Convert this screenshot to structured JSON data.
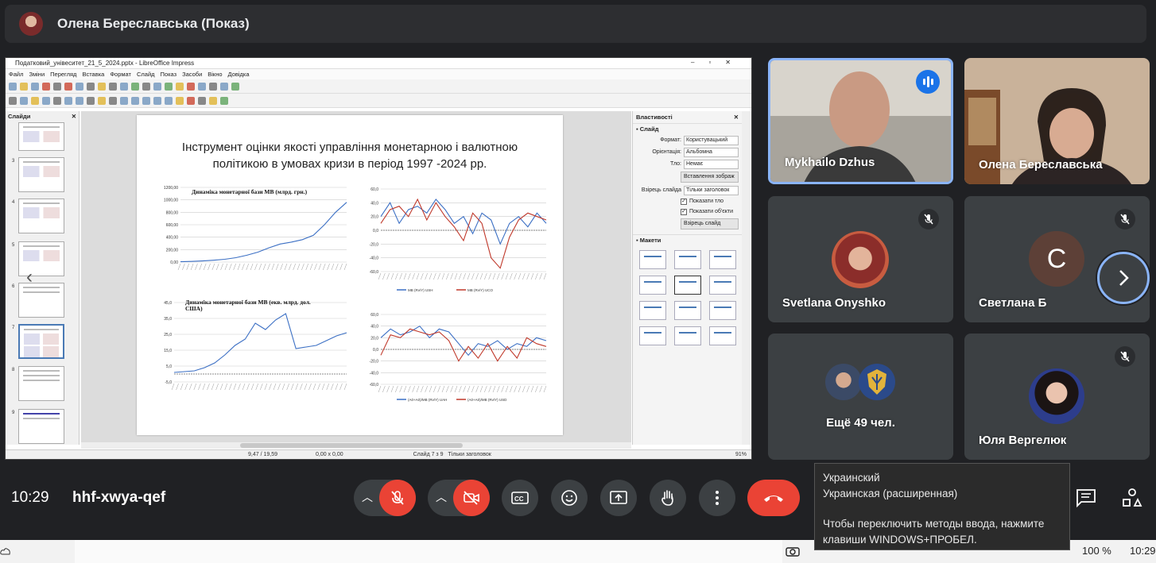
{
  "header": {
    "presenter_title": "Олена Береславська (Показ)"
  },
  "presentation": {
    "window_title": "Податковий_унівеситет_21_5_2024.pptx - LibreOffice Impress",
    "menu": [
      "Файл",
      "Зміни",
      "Перегляд",
      "Вставка",
      "Формат",
      "Слайд",
      "Показ",
      "Засоби",
      "Вікно",
      "Довідка"
    ],
    "slides_pane_title": "Слайди",
    "slide_numbers": [
      "3",
      "4",
      "5",
      "6",
      "7",
      "8",
      "9"
    ],
    "slide_title": "Інструмент оцінки якості управління монетарною і валютною політикою в умовах кризи в період 1997 -2024 рр.",
    "properties": {
      "title": "Властивості",
      "section_slide": "Слайд",
      "format_label": "Формат:",
      "format_value": "Користувацький",
      "orientation_label": "Орієнтація:",
      "orientation_value": "Альбомна",
      "background_label": "Тло:",
      "background_value": "Немає",
      "insert_image": "Вставлення зображ",
      "master_label": "Взірець слайда",
      "master_value": "Тільки заголовок",
      "show_bg": "Показати тло",
      "show_objects": "Показати об'єкти",
      "master_slide_btn": "Взірець слайд",
      "section_layouts": "Макети"
    },
    "status": {
      "position": "9,47 / 19,59",
      "size": "0,00 x 0,00",
      "slide_info": "Слайд 7 з 9",
      "layout_name": "Тільки заголовок",
      "zoom": "91%"
    }
  },
  "chart_data": [
    {
      "type": "line",
      "title": "Динаміка монетарної бази МВ (млрд. грн.)",
      "ylim": [
        0,
        1200
      ],
      "yticks": [
        "0,00",
        "200,00",
        "400,00",
        "600,00",
        "800,00",
        "1000,00",
        "1200,00"
      ],
      "series": [
        {
          "values": [
            5,
            10,
            18,
            30,
            45,
            70,
            110,
            160,
            230,
            290,
            320,
            360,
            430,
            600,
            800,
            960
          ]
        }
      ]
    },
    {
      "type": "line",
      "ylim": [
        -60,
        60
      ],
      "yticks": [
        "-60,0",
        "-40,0",
        "-20,0",
        "0,0",
        "20,0",
        "40,0",
        "60,0"
      ],
      "legend": [
        "MB (Rv/Y) USH",
        "MB (Rv/Y) UCO"
      ],
      "series": [
        {
          "name": "MB (Rv/Y) USH",
          "values": [
            20,
            40,
            10,
            30,
            35,
            25,
            45,
            30,
            10,
            20,
            -5,
            25,
            15,
            -20,
            10,
            20,
            5,
            25,
            10
          ]
        },
        {
          "name": "MB (Rv/Y) UCO",
          "values": [
            10,
            30,
            35,
            20,
            45,
            15,
            40,
            20,
            5,
            -15,
            25,
            10,
            -40,
            -55,
            -10,
            15,
            25,
            20,
            15
          ]
        }
      ]
    },
    {
      "type": "line",
      "title": "Динаміка монетарної бази МВ (екв. млрд. дол. США)",
      "ylim": [
        -5,
        45
      ],
      "yticks": [
        "-5,0",
        "5,0",
        "15,0",
        "25,0",
        "35,0",
        "45,0"
      ],
      "series": [
        {
          "values": [
            1,
            1.5,
            2,
            4,
            7,
            12,
            18,
            22,
            32,
            28,
            34,
            38,
            16,
            17,
            18,
            21,
            24,
            26
          ]
        }
      ]
    },
    {
      "type": "line",
      "ylim": [
        -60,
        60
      ],
      "yticks": [
        "-60,0",
        "-40,0",
        "-20,0",
        "0,0",
        "20,0",
        "40,0",
        "60,0"
      ],
      "legend": [
        "(А0+А0)/МВ (Rv/Y) UAH",
        "(А0+А0)/МВ (Rv/Y) USD"
      ],
      "series": [
        {
          "name": "(А0+А0)/МВ (Rv/Y) UAH",
          "values": [
            20,
            35,
            25,
            30,
            40,
            20,
            35,
            30,
            10,
            -10,
            10,
            5,
            15,
            0,
            10,
            5,
            20,
            15
          ]
        },
        {
          "name": "(А0+А0)/МВ (Rv/Y) USD",
          "values": [
            -10,
            25,
            20,
            35,
            30,
            25,
            30,
            15,
            -20,
            5,
            -15,
            10,
            -20,
            5,
            -15,
            20,
            10,
            5
          ]
        }
      ]
    }
  ],
  "participants": [
    {
      "name": "Mykhailo Dzhus"
    },
    {
      "name": "Олена Береславська"
    },
    {
      "name": "Svetlana Onyshko"
    },
    {
      "name": "Светлана Б",
      "initial": "С"
    },
    {
      "name": "Ещё 49 чел."
    },
    {
      "name": "Юля Вергелюк"
    }
  ],
  "meeting": {
    "time": "10:29",
    "code": "hhf-xwya-qef"
  },
  "ime_popup": {
    "line1": "Украинский",
    "line2": "Украинская (расширенная)",
    "line3": "Чтобы переключить методы ввода, нажмите клавиши WINDOWS+ПРОБЕЛ."
  },
  "taskbar": {
    "zoom": "100 %",
    "clock": "10:29"
  },
  "colors": {
    "accent_blue": "#8ab4f8",
    "end_call_red": "#ea4335",
    "tile_bg": "#3c4043"
  }
}
